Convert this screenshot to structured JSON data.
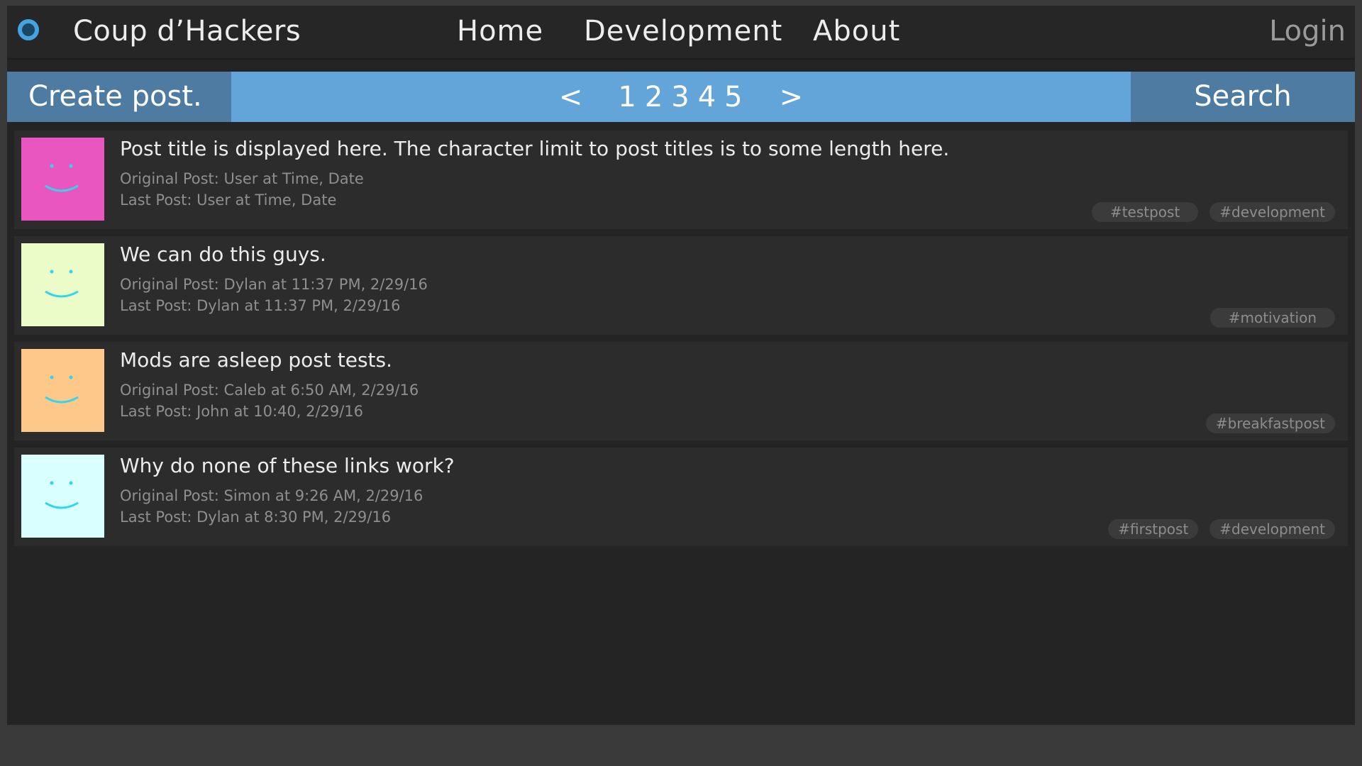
{
  "header": {
    "brand": "Coup d’Hackers",
    "nav": [
      "Home",
      "Development",
      "About"
    ],
    "login_label": "Login"
  },
  "actionbar": {
    "create_label": "Create post.",
    "prev_label": "<",
    "next_label": ">",
    "pages": [
      "1",
      "2",
      "3",
      "4",
      "5"
    ],
    "search_label": "Search"
  },
  "posts": [
    {
      "title": "Post title is displayed here. The character limit to post titles is to some length here.",
      "original": "Original Post: User at Time, Date",
      "last": "Last Post: User at Time, Date",
      "avatar_color": "#ea56c0",
      "tags": [
        "#testpost",
        "#development"
      ]
    },
    {
      "title": "We can do this guys.",
      "original": "Original Post: Dylan at 11:37 PM, 2/29/16",
      "last": "Last Post: Dylan at 11:37 PM, 2/29/16",
      "avatar_color": "#ecfcc8",
      "tags": [
        "#motivation"
      ]
    },
    {
      "title": "Mods are asleep post tests.",
      "original": "Original Post: Caleb at 6:50 AM, 2/29/16",
      "last": "Last Post: John at 10:40, 2/29/16",
      "avatar_color": "#fec88a",
      "tags": [
        "#breakfastpost"
      ]
    },
    {
      "title": "Why do none of these links work?",
      "original": "Original Post: Simon at 9:26 AM, 2/29/16",
      "last": "Last Post: Dylan at 8:30 PM, 2/29/16",
      "avatar_color": "#d9ffff",
      "tags": [
        "#firstpost",
        "#development"
      ]
    }
  ],
  "colors": {
    "accent": "#64a5d9",
    "accent_dark": "#4d7ba1",
    "logo": "#44a3e0",
    "smile": "#2fd7ee"
  }
}
